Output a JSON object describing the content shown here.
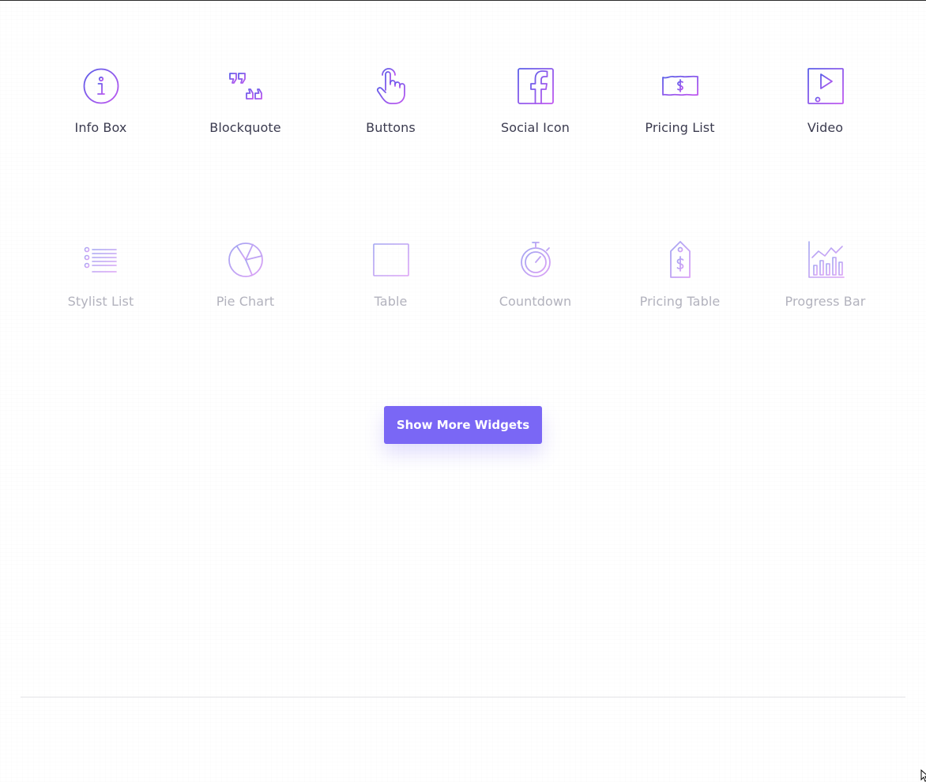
{
  "colors": {
    "accent": "#7a67f5",
    "icon_gradient_start": "#5b5ee8",
    "icon_gradient_end": "#c058f0",
    "label_active": "#3b3b4f",
    "label_faded": "#b2b2bd"
  },
  "widgets_row1": [
    {
      "label": "Info Box",
      "icon": "info-circle-icon"
    },
    {
      "label": "Blockquote",
      "icon": "quote-marks-icon"
    },
    {
      "label": "Buttons",
      "icon": "pointer-hand-icon"
    },
    {
      "label": "Social Icon",
      "icon": "facebook-icon"
    },
    {
      "label": "Pricing List",
      "icon": "dollar-bill-icon"
    },
    {
      "label": "Video",
      "icon": "video-player-icon"
    }
  ],
  "widgets_row2": [
    {
      "label": "Stylist List",
      "icon": "bullet-list-icon"
    },
    {
      "label": "Pie Chart",
      "icon": "pie-chart-icon"
    },
    {
      "label": "Table",
      "icon": "table-grid-icon"
    },
    {
      "label": "Countdown",
      "icon": "stopwatch-icon"
    },
    {
      "label": "Pricing Table",
      "icon": "price-tag-icon"
    },
    {
      "label": "Progress Bar",
      "icon": "bar-chart-icon"
    }
  ],
  "actions": {
    "show_more_label": "Show More Widgets"
  }
}
